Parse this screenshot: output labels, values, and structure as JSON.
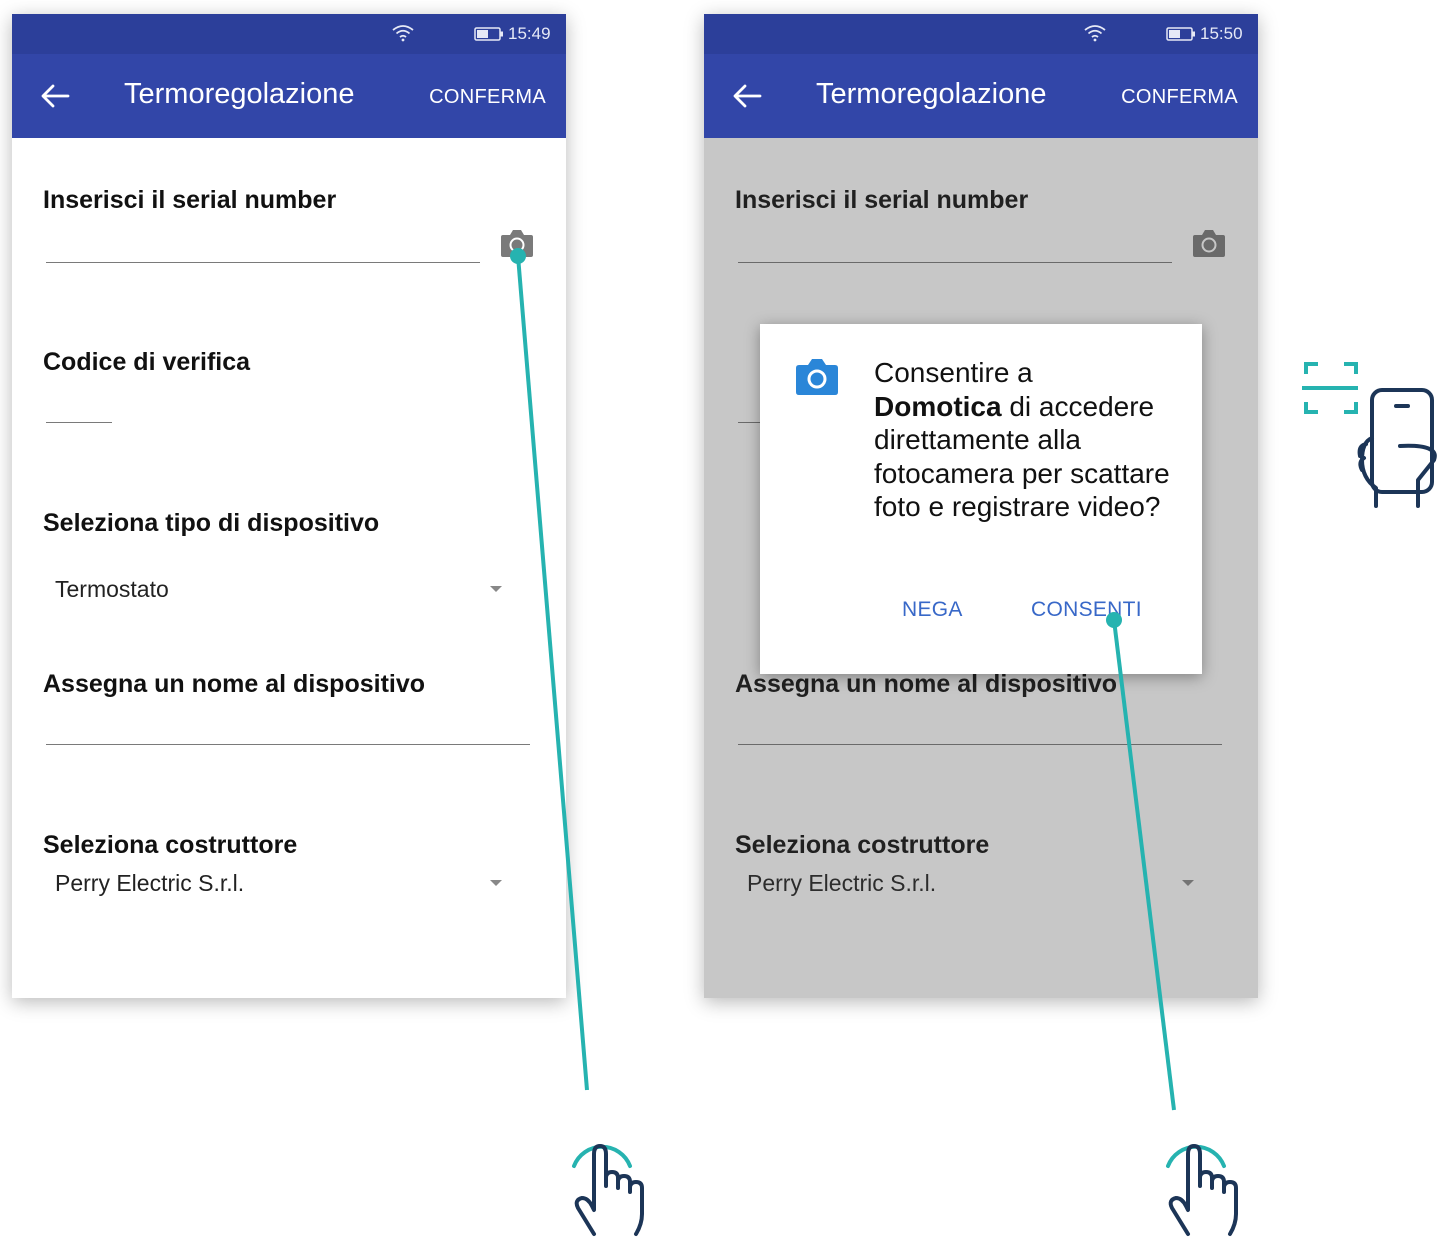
{
  "left_screen": {
    "status": {
      "time": "15:49"
    },
    "appbar": {
      "title": "Termoregolazione",
      "confirm_label": "CONFERMA"
    },
    "form": {
      "serial_label": "Inserisci il serial number",
      "verify_label": "Codice di verifica",
      "device_type_label": "Seleziona tipo di dispositivo",
      "device_type_value": "Termostato",
      "device_name_label": "Assegna un nome al dispositivo",
      "manufacturer_label": "Seleziona costruttore",
      "manufacturer_value": "Perry Electric S.r.l."
    }
  },
  "right_screen": {
    "status": {
      "time": "15:50"
    },
    "appbar": {
      "title": "Termoregolazione",
      "confirm_label": "CONFERMA"
    },
    "form": {
      "serial_label": "Inserisci il serial number",
      "device_name_label": "Assegna un nome al dispositivo",
      "manufacturer_label": "Seleziona costruttore",
      "manufacturer_value": "Perry Electric S.r.l."
    },
    "dialog": {
      "message_prefix": "Consentire a",
      "app_name": "Domotica",
      "message_suffix": "di accedere direttamente alla fotocamera per scattare foto e registrare video?",
      "deny_label": "NEGA",
      "allow_label": "CONSENTI"
    }
  },
  "colors": {
    "status_bar": "#2c3f9a",
    "app_bar": "#3246a8",
    "accent_line": "#26b3b0",
    "dialog_button": "#3868c8",
    "camera_icon": "#2a86d8",
    "hand_icon": "#1c3557"
  },
  "icons": [
    "wifi-icon",
    "battery-icon",
    "back-arrow-icon",
    "camera-icon",
    "dropdown-caret-icon",
    "tap-hand-icon",
    "scan-phone-icon"
  ]
}
